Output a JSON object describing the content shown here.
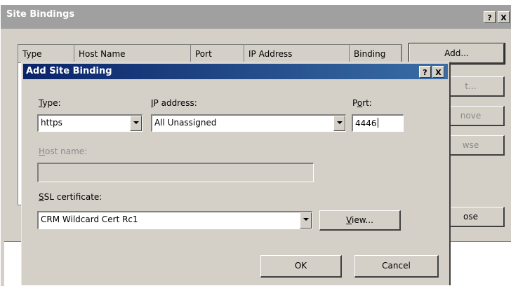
{
  "outer_window": {
    "title": "Site Bindings",
    "help_glyph": "?",
    "close_glyph": "X",
    "columns": [
      "Type",
      "Host Name",
      "Port",
      "IP Address",
      "Binding"
    ],
    "buttons": {
      "add": "Add...",
      "edit": "t...",
      "remove": "nove",
      "browse": "wse",
      "close": "ose"
    }
  },
  "dialog": {
    "title": "Add Site Binding",
    "help_glyph": "?",
    "close_glyph": "X",
    "type": {
      "label_key": "T",
      "label_rest": "ype:",
      "value": "https"
    },
    "ip": {
      "label_key": "I",
      "label_rest": "P address:",
      "value": "All Unassigned"
    },
    "port": {
      "label_pre": "P",
      "label_key": "o",
      "label_rest": "rt:",
      "value": "4446"
    },
    "host": {
      "label_key": "H",
      "label_rest": "ost name:",
      "value": ""
    },
    "ssl": {
      "label_key": "S",
      "label_rest": "SL certificate:",
      "value": "CRM Wildcard Cert Rc1"
    },
    "view_button": {
      "key": "V",
      "rest": "iew..."
    },
    "ok_label": "OK",
    "cancel_label": "Cancel"
  }
}
